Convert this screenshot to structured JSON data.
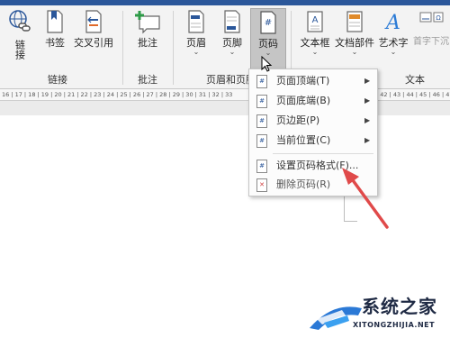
{
  "ribbon": {
    "buttons": {
      "link": "链接",
      "bookmark": "书签",
      "cross_ref": "交叉引用",
      "comment": "批注",
      "header": "页眉",
      "footer": "页脚",
      "page_number": "页码",
      "text_box": "文本框",
      "doc_parts": "文档部件",
      "wordart": "艺术字",
      "dropcap": "首字下沉"
    },
    "groups": {
      "links": "链接",
      "comments": "批注",
      "header_footer": "页眉和页脚",
      "text": "文本"
    }
  },
  "ruler": {
    "left_ticks": "16 | 17 | 18 | 19 | 20 | 21 | 22 | 23 | 24 | 25 | 26 | 27 | 28 | 29 | 30 | 31 | 32 | 33",
    "right_ticks": "| 42 | 43 | 44 | 45 | 46 | 47 | 48 |"
  },
  "page_number_menu": {
    "items": [
      {
        "label": "页面顶端(T)",
        "has_submenu": true
      },
      {
        "label": "页面底端(B)",
        "has_submenu": true
      },
      {
        "label": "页边距(P)",
        "has_submenu": true
      },
      {
        "label": "当前位置(C)",
        "has_submenu": true
      },
      {
        "label": "设置页码格式(F)...",
        "has_submenu": false
      },
      {
        "label": "删除页码(R)",
        "has_submenu": false
      }
    ]
  },
  "watermark": {
    "name": "系统之家",
    "url": "XITONGZHIJIA.NET"
  },
  "colors": {
    "accent": "#2b579a",
    "annotation_arrow": "#e04a4a",
    "ribbon_bg": "#f3f3f3"
  }
}
